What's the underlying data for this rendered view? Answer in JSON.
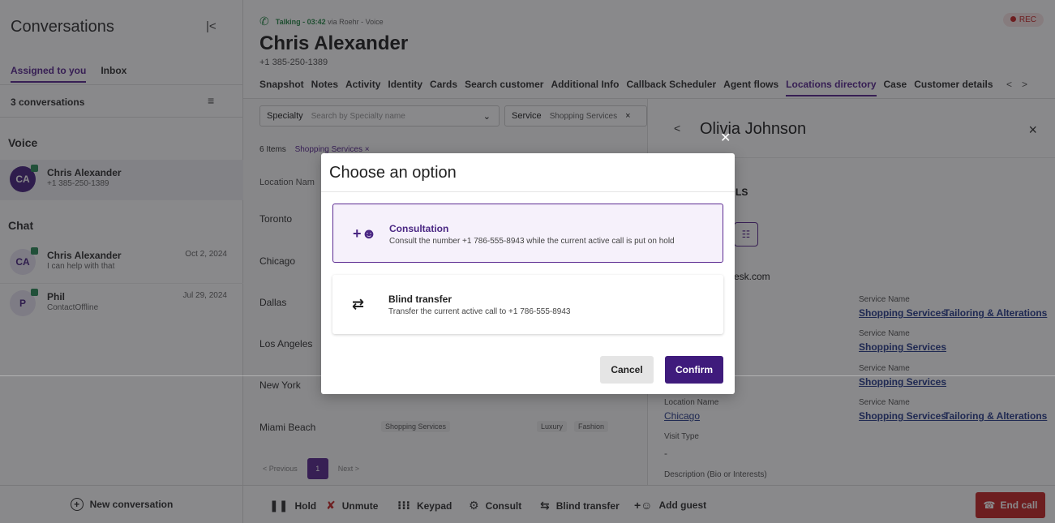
{
  "sidebar": {
    "title": "Conversations",
    "collapse_icon": "collapse-left-icon",
    "tabs": [
      {
        "label": "Assigned to you"
      },
      {
        "label": "Inbox"
      }
    ],
    "count": "3 conversations",
    "voice_section": "Voice",
    "chat_section": "Chat",
    "voice_items": [
      {
        "initials": "CA",
        "name": "Chris Alexander",
        "sub": "+1 385-250-1389"
      }
    ],
    "chat_items": [
      {
        "initials": "CA",
        "name": "Chris Alexander",
        "sub": "I can help with that",
        "date": "Oct 2, 2024"
      },
      {
        "initials": "P",
        "name": "Phil",
        "sub": "ContactOffline",
        "date": "Jul 29, 2024"
      }
    ],
    "new_conversation": "New conversation"
  },
  "header": {
    "status": "Talking - 03:42",
    "via": "via Roehr - Voice",
    "rec": "REC",
    "customer_name": "Chris Alexander",
    "customer_phone": "+1 385-250-1389",
    "tabs": [
      "Snapshot",
      "Notes",
      "Activity",
      "Identity",
      "Cards",
      "Search customer",
      "Additional Info",
      "Callback Scheduler",
      "Agent flows",
      "Locations directory",
      "Case",
      "Customer details"
    ],
    "active_tab": "Locations directory"
  },
  "locations": {
    "specialty_label": "Specialty",
    "specialty_placeholder": "Search by Specialty name",
    "service_label": "Service",
    "service_value": "Shopping Services",
    "items_count": "6 Items",
    "chip": "Shopping Services",
    "column_location": "Location Nam",
    "rows": [
      "Toronto",
      "Chicago",
      "Dallas",
      "Los Angeles",
      "New York",
      "Miami Beach"
    ],
    "miami_tags": [
      "Shopping Services",
      "Luxury",
      "Fashion"
    ],
    "pager": {
      "prev": "Previous",
      "page": "1",
      "next": "Next"
    }
  },
  "detail": {
    "name": "Olivia Johnson",
    "heading_partial": "LS",
    "email_partial": "esk.com",
    "service_label": "Service Name",
    "services": [
      [
        "Shopping Services",
        "Tailoring & Alterations"
      ],
      [
        "Shopping Services"
      ],
      [
        "Shopping Services"
      ],
      [
        "Shopping Services",
        "Tailoring & Alterations"
      ]
    ],
    "location_label": "Location Name",
    "location_value": "Chicago",
    "visit_label": "Visit Type",
    "visit_value": "-",
    "description_label": "Description (Bio or Interests)"
  },
  "callbar": {
    "hold": "Hold",
    "unmute": "Unmute",
    "keypad": "Keypad",
    "consult": "Consult",
    "blind_transfer": "Blind transfer",
    "add_guest": "Add guest",
    "end_call": "End call"
  },
  "modal": {
    "title": "Choose an option",
    "options": [
      {
        "title": "Consultation",
        "desc": "Consult the number +1 786-555-8943 while the current active call is put on hold",
        "icon": "person-add-icon"
      },
      {
        "title": "Blind transfer",
        "desc": "Transfer the current active call to +1 786-555-8943",
        "icon": "swap-arrows-icon"
      }
    ],
    "cancel": "Cancel",
    "confirm": "Confirm"
  },
  "colors": {
    "brand": "#5b2a91",
    "confirm": "#3f1b7c",
    "end_call": "#c62828",
    "talking": "#2b8a4a"
  }
}
